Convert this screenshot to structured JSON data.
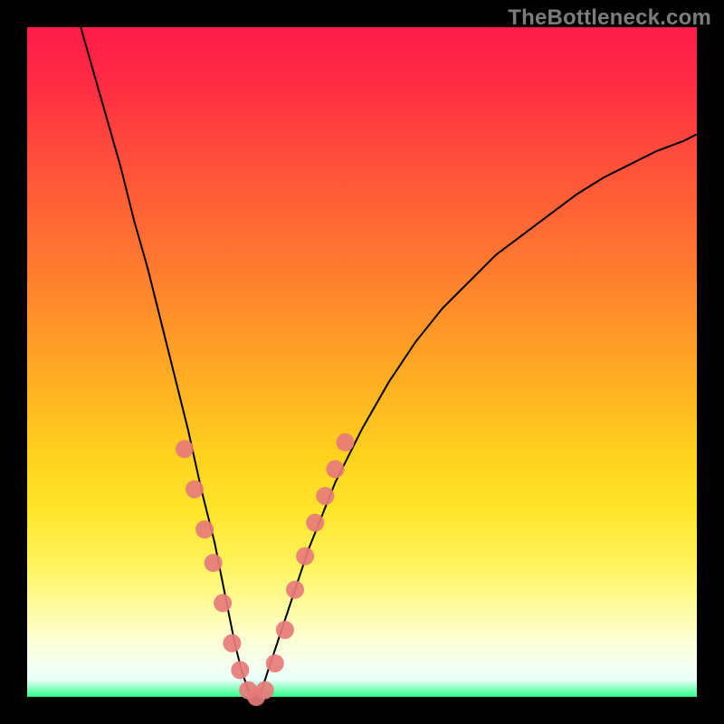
{
  "watermark": "TheBottleneck.com",
  "chart_data": {
    "type": "line",
    "title": "",
    "xlabel": "",
    "ylabel": "",
    "xlim": [
      0,
      100
    ],
    "ylim": [
      0,
      100
    ],
    "grid": false,
    "legend": false,
    "series": [
      {
        "name": "bottleneck-curve",
        "x": [
          8,
          10,
          12,
          14,
          16,
          18,
          20,
          22,
          24,
          26,
          27,
          28,
          29,
          30,
          31,
          32,
          33,
          34,
          35,
          36,
          38,
          40,
          42,
          44,
          46,
          50,
          54,
          58,
          62,
          66,
          70,
          74,
          78,
          82,
          86,
          90,
          94,
          98,
          100
        ],
        "values": [
          100,
          93,
          86,
          79,
          71,
          64,
          56,
          48,
          40,
          31,
          27,
          23,
          18,
          13,
          8,
          4,
          1,
          0,
          1,
          4,
          10,
          16,
          22,
          27,
          32,
          40,
          47,
          53,
          58,
          62,
          66,
          69,
          72,
          75,
          77.5,
          79.5,
          81.5,
          83,
          84
        ]
      }
    ],
    "markers": {
      "name": "highlighted-points",
      "color": "#e77b7b",
      "points": [
        {
          "x": 23.5,
          "y": 37
        },
        {
          "x": 25.0,
          "y": 31
        },
        {
          "x": 26.5,
          "y": 25
        },
        {
          "x": 27.8,
          "y": 20
        },
        {
          "x": 29.2,
          "y": 14
        },
        {
          "x": 30.6,
          "y": 8
        },
        {
          "x": 31.8,
          "y": 4
        },
        {
          "x": 33.0,
          "y": 1
        },
        {
          "x": 34.2,
          "y": 0
        },
        {
          "x": 35.5,
          "y": 1
        },
        {
          "x": 37.0,
          "y": 5
        },
        {
          "x": 38.5,
          "y": 10
        },
        {
          "x": 40.0,
          "y": 16
        },
        {
          "x": 41.5,
          "y": 21
        },
        {
          "x": 43.0,
          "y": 26
        },
        {
          "x": 44.5,
          "y": 30
        },
        {
          "x": 46.0,
          "y": 34
        },
        {
          "x": 47.5,
          "y": 38
        }
      ]
    },
    "background_gradient": {
      "top": "#ff1b48",
      "mid": "#ffd21e",
      "bottom": "#2bff88"
    }
  }
}
